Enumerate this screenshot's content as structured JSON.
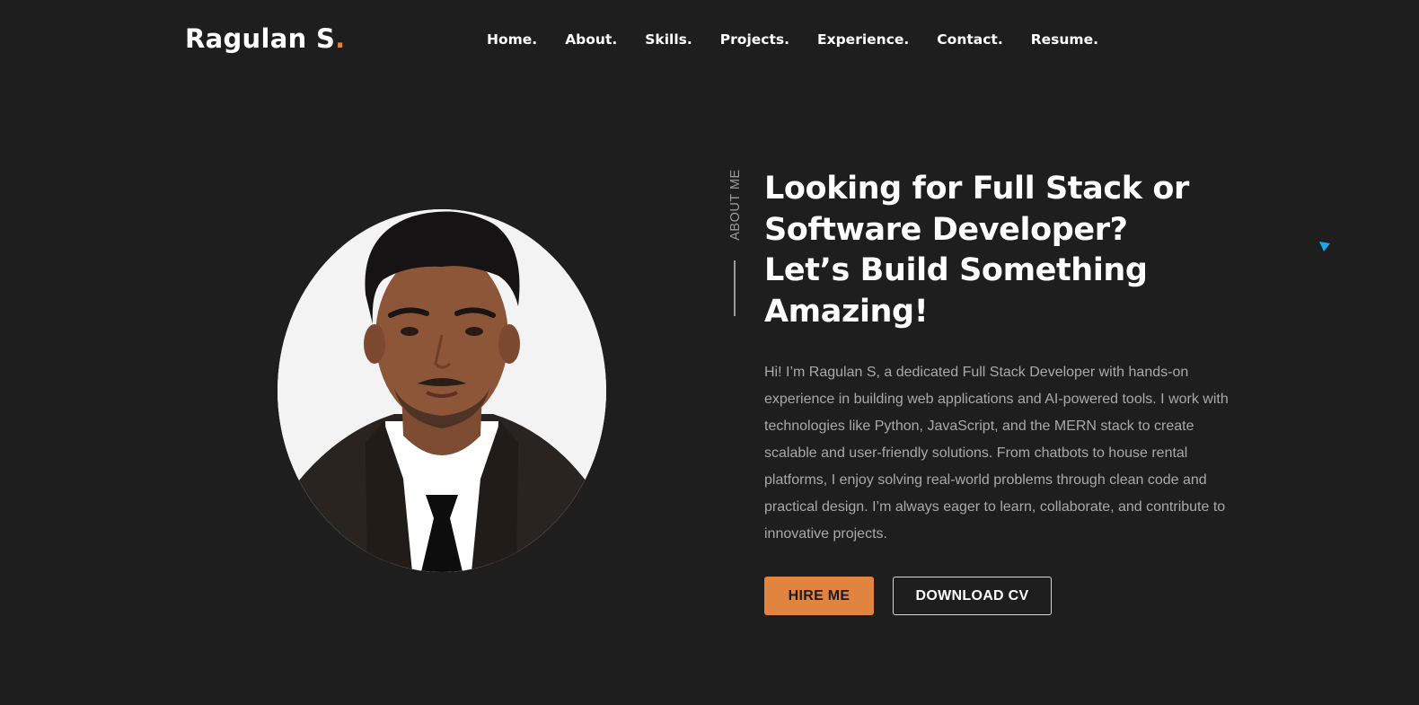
{
  "nav": {
    "logo": "Ragulan S",
    "logo_dot": ".",
    "links": [
      "Home.",
      "About.",
      "Skills.",
      "Projects.",
      "Experience.",
      "Contact.",
      "Resume."
    ]
  },
  "about": {
    "side_label": "ABOUT ME",
    "headline": [
      "Looking for Full Stack or",
      "Software Developer?",
      "Let’s Build Something",
      "Amazing!"
    ],
    "bio": "Hi! I’m Ragulan S, a dedicated Full Stack Developer with hands-on experience in building web applications and AI-powered tools. I work with technologies like Python, JavaScript, and the MERN stack to create scalable and user-friendly solutions. From chatbots to house rental platforms, I enjoy solving real-world problems through clean code and practical design. I’m always eager to learn, collaborate, and contribute to innovative projects.",
    "hire_button": "HIRE ME",
    "cv_button": "DOWNLOAD CV"
  },
  "colors": {
    "background": "#1e1e1e",
    "accent": "#e0843f",
    "muted_text": "#a9a9a9",
    "cursor": "#1fa6e8"
  },
  "icons": {
    "cursor": "cursor-arrow-icon"
  }
}
